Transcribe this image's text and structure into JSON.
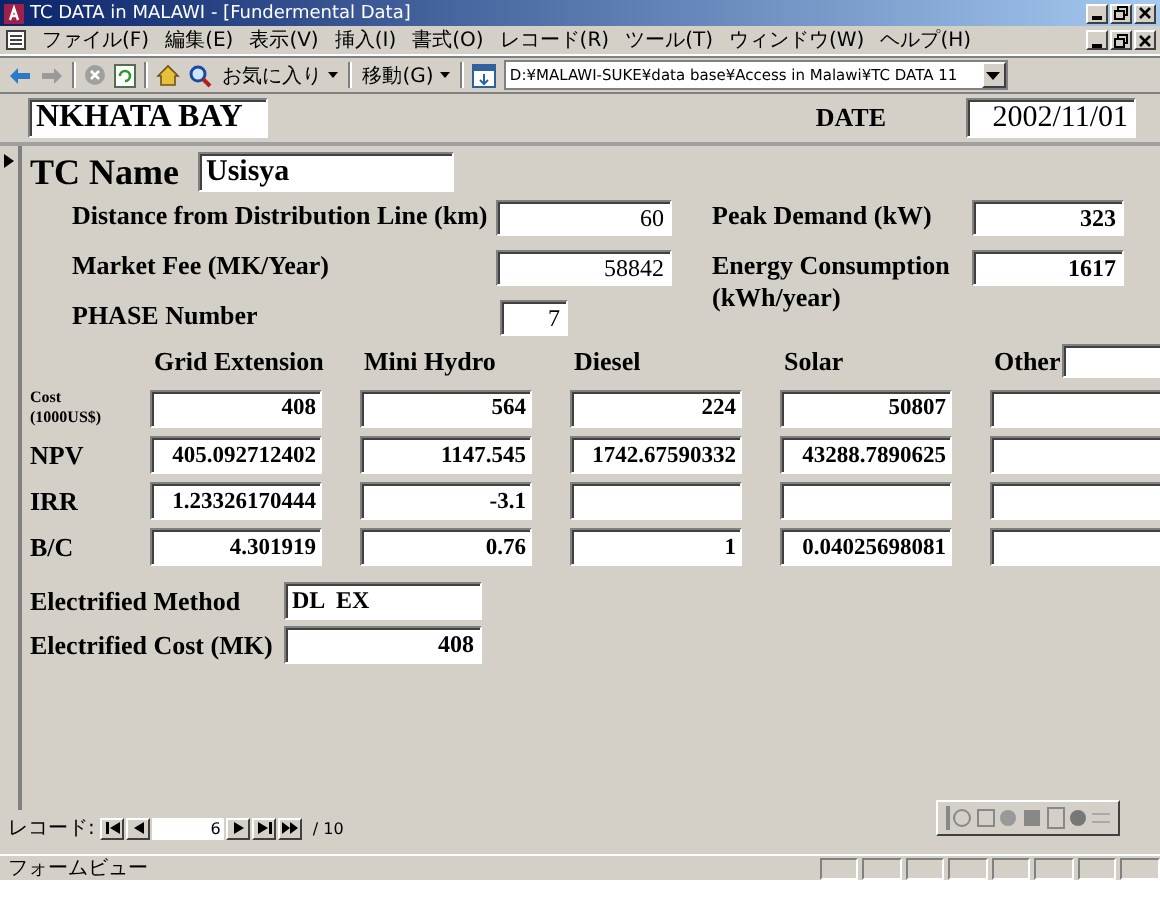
{
  "window": {
    "title": "TC DATA in MALAWI - [Fundermental Data]"
  },
  "menu": [
    "ファイル(F)",
    "編集(E)",
    "表示(V)",
    "挿入(I)",
    "書式(O)",
    "レコード(R)",
    "ツール(T)",
    "ウィンドウ(W)",
    "ヘルプ(H)"
  ],
  "toolbar": {
    "favorites": "お気に入り",
    "go": "移動(G)",
    "address": "D:¥MALAWI-SUKE¥data base¥Access in Malawi¥TC DATA 11"
  },
  "header": {
    "site": "NKHATA BAY",
    "date_label": "DATE",
    "date": "2002/11/01"
  },
  "form": {
    "name_label": "TC Name",
    "name": "Usisya",
    "left_fields": [
      {
        "label": "Distance from Distribution Line (km)",
        "value": "60"
      },
      {
        "label": "Market Fee (MK/Year)",
        "value": "58842"
      },
      {
        "label": "PHASE Number",
        "value": "7"
      }
    ],
    "right_fields": [
      {
        "label": "Peak Demand (kW)",
        "value": "323"
      },
      {
        "label": "Energy Consumption (kWh/year)",
        "value": "1617"
      }
    ]
  },
  "comparison": {
    "columns": [
      "Grid Extension",
      "Mini Hydro",
      "Diesel",
      "Solar",
      "Other"
    ],
    "rows": [
      {
        "label": "Cost (1000US$)",
        "kind": "small",
        "values": [
          "408",
          "564",
          "224",
          "50807"
        ]
      },
      {
        "label": "NPV",
        "kind": "normal",
        "values": [
          "405.092712402",
          "1147.545",
          "1742.67590332",
          "43288.7890625"
        ]
      },
      {
        "label": "IRR",
        "kind": "normal",
        "values": [
          "1.23326170444",
          "-3.1"
        ]
      },
      {
        "label": "B/C",
        "kind": "normal",
        "values": [
          "4.301919",
          "0.76",
          "1",
          "0.04025698081"
        ]
      }
    ]
  },
  "result": [
    {
      "label": "Electrified Method",
      "value": "DL  EX",
      "kind": "text"
    },
    {
      "label": "Electrified Cost (MK)",
      "value": "408",
      "kind": "number"
    }
  ],
  "navigator": {
    "label": "レコード:",
    "current": "6",
    "total": "/ 10"
  },
  "status_bar": {
    "text": "フォームビュー"
  }
}
